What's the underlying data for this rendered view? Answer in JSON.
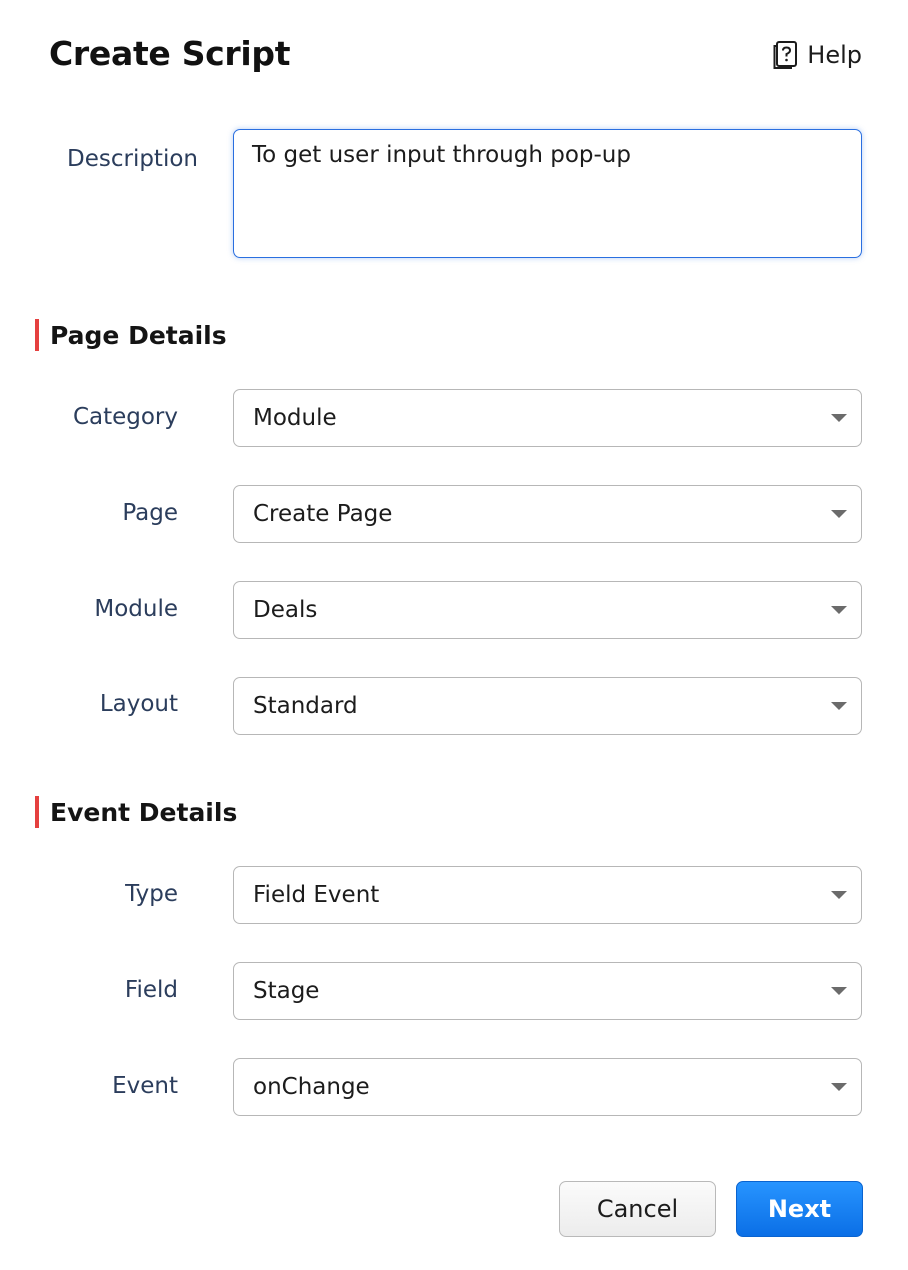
{
  "header": {
    "title": "Create Script",
    "help_label": "Help",
    "help_icon": "help-book-icon"
  },
  "description": {
    "label": "Description",
    "value": "To get user input through pop-up"
  },
  "page_details": {
    "heading": "Page Details",
    "category": {
      "label": "Category",
      "value": "Module"
    },
    "page": {
      "label": "Page",
      "value": "Create Page"
    },
    "module": {
      "label": "Module",
      "value": "Deals"
    },
    "layout": {
      "label": "Layout",
      "value": "Standard"
    }
  },
  "event_details": {
    "heading": "Event Details",
    "type": {
      "label": "Type",
      "value": "Field Event"
    },
    "field": {
      "label": "Field",
      "value": "Stage"
    },
    "event": {
      "label": "Event",
      "value": "onChange"
    }
  },
  "footer": {
    "cancel_label": "Cancel",
    "next_label": "Next"
  },
  "colors": {
    "section_accent": "#e5403f",
    "primary_button": "#1580f2",
    "focus_border": "#2a6fe0"
  }
}
